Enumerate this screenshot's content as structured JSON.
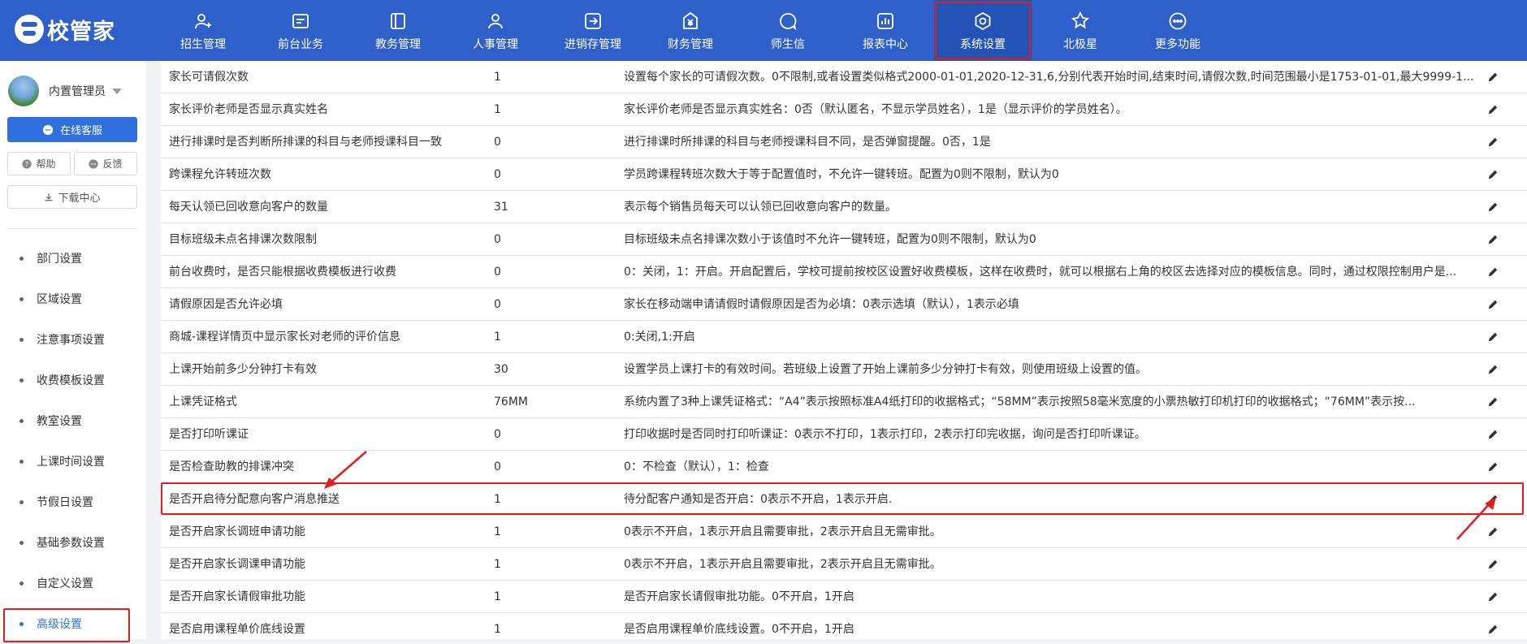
{
  "app": {
    "logo_text": "校管家"
  },
  "nav": {
    "items": [
      {
        "label": "招生管理",
        "icon": "add-user-icon"
      },
      {
        "label": "前台业务",
        "icon": "front-desk-icon"
      },
      {
        "label": "教务管理",
        "icon": "book-icon"
      },
      {
        "label": "人事管理",
        "icon": "person-icon"
      },
      {
        "label": "进销存管理",
        "icon": "inventory-icon"
      },
      {
        "label": "财务管理",
        "icon": "yen-icon"
      },
      {
        "label": "师生信",
        "icon": "message-icon"
      },
      {
        "label": "报表中心",
        "icon": "report-icon"
      },
      {
        "label": "系统设置",
        "icon": "settings-icon",
        "active": true
      },
      {
        "label": "北极星",
        "icon": "star-icon"
      },
      {
        "label": "更多功能",
        "icon": "more-icon"
      }
    ]
  },
  "sidebar": {
    "user_name": "内置管理员",
    "service_button": "在线客服",
    "help_button": "帮助",
    "feedback_button": "反馈",
    "download_button": "下载中心",
    "menu": [
      {
        "label": "部门设置"
      },
      {
        "label": "区域设置"
      },
      {
        "label": "注意事项设置"
      },
      {
        "label": "收费模板设置"
      },
      {
        "label": "教室设置"
      },
      {
        "label": "上课时间设置"
      },
      {
        "label": "节假日设置"
      },
      {
        "label": "基础参数设置"
      },
      {
        "label": "自定义设置"
      },
      {
        "label": "高级设置",
        "active": true
      }
    ]
  },
  "table": {
    "rows": [
      {
        "name": "家长可请假次数",
        "value": "1",
        "desc": "设置每个家长的可请假次数。0不限制,或者设置类似格式2000-01-01,2020-12-31,6,分别代表开始时间,结束时间,请假次数,时间范围最小是1753-01-01,最大9999-1..."
      },
      {
        "name": "家长评价老师是否显示真实姓名",
        "value": "1",
        "desc": "家长评价老师是否显示真实姓名：0否（默认匿名，不显示学员姓名），1是（显示评价的学员姓名）。"
      },
      {
        "name": "进行排课时是否判断所排课的科目与老师授课科目一致",
        "value": "0",
        "desc": "进行排课时所排课的科目与老师授课科目不同，是否弹窗提醒。0否，1是"
      },
      {
        "name": "跨课程允许转班次数",
        "value": "0",
        "desc": "学员跨课程转班次数大于等于配置值时，不允许一键转班。配置为0则不限制，默认为0"
      },
      {
        "name": "每天认领已回收意向客户的数量",
        "value": "31",
        "desc": "表示每个销售员每天可以认领已回收意向客户的数量。"
      },
      {
        "name": "目标班级未点名排课次数限制",
        "value": "0",
        "desc": "目标班级未点名排课次数小于该值时不允许一键转班，配置为0则不限制，默认为0"
      },
      {
        "name": "前台收费时，是否只能根据收费模板进行收费",
        "value": "0",
        "desc": "0：关闭，1：开启。开启配置后，学校可提前按校区设置好收费模板，这样在收费时，就可以根据右上角的校区去选择对应的模板信息。同时，通过权限控制用户是..."
      },
      {
        "name": "请假原因是否允许必填",
        "value": "0",
        "desc": "家长在移动端申请请假时请假原因是否为必填：0表示选填（默认），1表示必填"
      },
      {
        "name": "商城-课程详情页中显示家长对老师的评价信息",
        "value": "1",
        "desc": "0:关闭,1:开启"
      },
      {
        "name": "上课开始前多少分钟打卡有效",
        "value": "30",
        "desc": "设置学员上课打卡的有效时间。若班级上设置了开始上课前多少分钟打卡有效，则使用班级上设置的值。"
      },
      {
        "name": "上课凭证格式",
        "value": "76MM",
        "desc": "系统内置了3种上课凭证格式：“A4”表示按照标准A4纸打印的收据格式；“58MM”表示按照58毫米宽度的小票热敏打印机打印的收据格式；“76MM”表示按..."
      },
      {
        "name": "是否打印听课证",
        "value": "0",
        "desc": "打印收据时是否同时打印听课证：0表示不打印，1表示打印，2表示打印完收据，询问是否打印听课证。"
      },
      {
        "name": "是否检查助教的排课冲突",
        "value": "0",
        "desc": "0：不检查（默认），1：检查"
      },
      {
        "name": "是否开启待分配意向客户消息推送",
        "value": "1",
        "desc": "待分配客户通知是否开启：0表示不开启，1表示开启."
      },
      {
        "name": "是否开启家长调班申请功能",
        "value": "1",
        "desc": "0表示不开启，1表示开启且需要审批，2表示开启且无需审批。"
      },
      {
        "name": "是否开启家长调课申请功能",
        "value": "1",
        "desc": "0表示不开启，1表示开启且需要审批，2表示开启且无需审批。"
      },
      {
        "name": "是否开启家长请假审批功能",
        "value": "1",
        "desc": "是否开启家长请假审批功能。0不开启，1开启"
      },
      {
        "name": "是否启用课程单价底线设置",
        "value": "1",
        "desc": "是否启用课程单价底线设置。0不开启，1开启"
      }
    ]
  },
  "colors": {
    "nav_bg": "#2f5fc9",
    "accent": "#2f6fde",
    "highlight": "#e01e1e"
  }
}
